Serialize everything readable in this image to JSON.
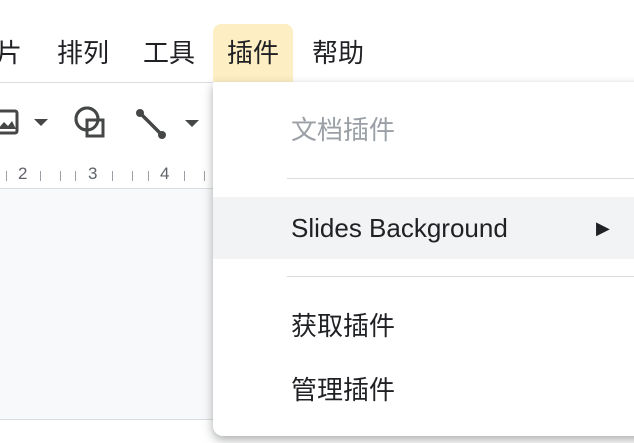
{
  "menubar": {
    "items": [
      {
        "label": "片"
      },
      {
        "label": "排列"
      },
      {
        "label": "工具"
      },
      {
        "label": "插件"
      },
      {
        "label": "帮助"
      }
    ],
    "active_item": "插件"
  },
  "toolbar": {
    "icons": [
      "image-icon",
      "dropdown-arrow-icon",
      "shape-icon",
      "line-icon",
      "dropdown-arrow-icon"
    ]
  },
  "ruler": {
    "numbers": [
      "2",
      "3",
      "4"
    ]
  },
  "addons_menu": {
    "header": "文档插件",
    "items": [
      {
        "label": "Slides Background",
        "submenu_indicator": "▶"
      },
      {
        "label": "获取插件"
      },
      {
        "label": "管理插件"
      }
    ]
  },
  "colors": {
    "active_menu_bg": "#fdefc3",
    "hover_row_bg": "#f1f3f4",
    "disabled_text": "#9aa0a6",
    "canvas_bg": "#f8f9fa"
  }
}
